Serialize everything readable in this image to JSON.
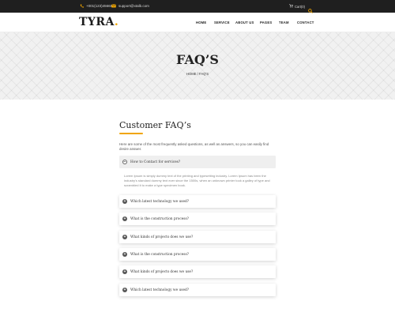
{
  "topbar": {
    "phone": "+001(123)456681",
    "email": "support@xtalb.com"
  },
  "header": {
    "logo_text": "TYRA",
    "logo_dot": ".",
    "nav": [
      "HOME",
      "SERVICE",
      "ABOUT US",
      "PAGES",
      "TEAM",
      "CONTACT"
    ],
    "cart_label": "Cart(0)"
  },
  "banner": {
    "title": "FAQ’S",
    "breadcrumb": "HOME  /  FAQ'S"
  },
  "content": {
    "title": "Customer FAQ’s",
    "intro": "Here are some of the most frequently asked questions, as well as answers, so you can easily find desire answer.",
    "faqs": [
      {
        "question": "How to Contact for services?",
        "open": true,
        "answer": "Lorem Ipsum is simply dummy text of the printing and typesetting industry. Lorem Ipsum has been the industry's standard dummy text ever since the 1500s, when an unknown printer took a galley of type and scrambled it to make a type specimen book."
      },
      {
        "question": "Which latest technology we used?",
        "open": false
      },
      {
        "question": "What is the construction process?",
        "open": false
      },
      {
        "question": "What kinds of projects does we use?",
        "open": false
      },
      {
        "question": "What is the construction process?",
        "open": false
      },
      {
        "question": "What kinds of projects does we use?",
        "open": false
      },
      {
        "question": "Which latest technology we used?",
        "open": false
      }
    ]
  },
  "colors": {
    "accent": "#f0a500",
    "topbar_bg": "#1f1f1f"
  },
  "icons": {
    "phone": "phone-icon",
    "email": "mail-icon",
    "cart": "cart-icon",
    "search": "search-icon",
    "faq_open": "minus-circle-icon",
    "faq_closed": "plus-circle-icon"
  }
}
